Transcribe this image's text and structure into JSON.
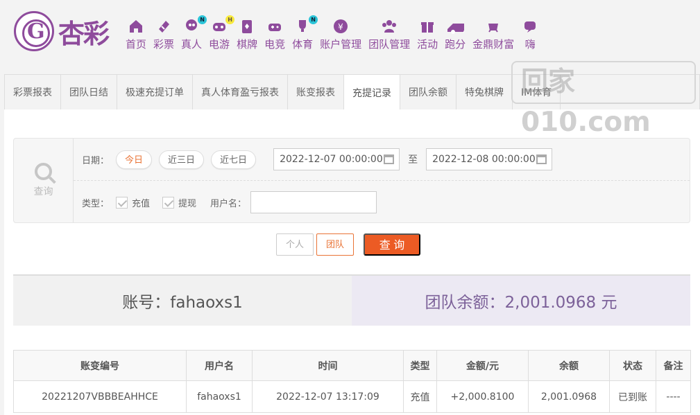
{
  "brand": {
    "name": "杏彩",
    "logo_letter": "G"
  },
  "nav": [
    {
      "label": "首页",
      "icon": "home-icon"
    },
    {
      "label": "彩票",
      "icon": "ticket-icon"
    },
    {
      "label": "真人",
      "icon": "live-dealer-icon",
      "badge": "N"
    },
    {
      "label": "电游",
      "icon": "gamepad-icon",
      "badge": "H"
    },
    {
      "label": "棋牌",
      "icon": "cards-icon"
    },
    {
      "label": "电竞",
      "icon": "controller-icon"
    },
    {
      "label": "体育",
      "icon": "trophy-icon",
      "badge": "N"
    },
    {
      "label": "账户管理",
      "icon": "yen-coin-icon"
    },
    {
      "label": "团队管理",
      "icon": "team-icon"
    },
    {
      "label": "活动",
      "icon": "gift-icon"
    },
    {
      "label": "跑分",
      "icon": "car-icon"
    },
    {
      "label": "金鼎财富",
      "icon": "cauldron-icon"
    },
    {
      "label": "嗨",
      "icon": "chat-icon"
    }
  ],
  "watermark": {
    "text": "回家010.com"
  },
  "tabs": [
    "彩票报表",
    "团队日结",
    "极速充提订单",
    "真人体育盈亏报表",
    "账变报表",
    "充提记录",
    "团队余额",
    "特兔棋牌",
    "IM体育"
  ],
  "active_tab": "充提记录",
  "filter": {
    "query_label": "查询",
    "date_label": "日期：",
    "date_presets": [
      "今日",
      "近三日",
      "近七日"
    ],
    "start_date": "2022-12-07 00:00:00",
    "to_label": "至",
    "end_date": "2022-12-08 00:00:00",
    "type_label": "类型：",
    "type_options": [
      "充值",
      "提现"
    ],
    "username_label": "用户名：",
    "username_value": ""
  },
  "actions": {
    "personal": "个人",
    "team": "团队",
    "submit": "查 询"
  },
  "summary": {
    "account": "账号：fahaoxs1",
    "team_balance": "团队余额：2,001.0968 元"
  },
  "table": {
    "headers": [
      "账变编号",
      "用户名",
      "时间",
      "类型",
      "金额/元",
      "余额",
      "状态",
      "备注"
    ],
    "rows": [
      [
        "20221207VBBBEAHHCE",
        "fahaoxs1",
        "2022-12-07 13:17:09",
        "充值",
        "+2,000.8100",
        "2,001.0968",
        "已到账",
        "----"
      ]
    ]
  },
  "colors": {
    "brand": "#8e4b9c",
    "accent": "#ec5b24",
    "success": "#4ca244"
  }
}
